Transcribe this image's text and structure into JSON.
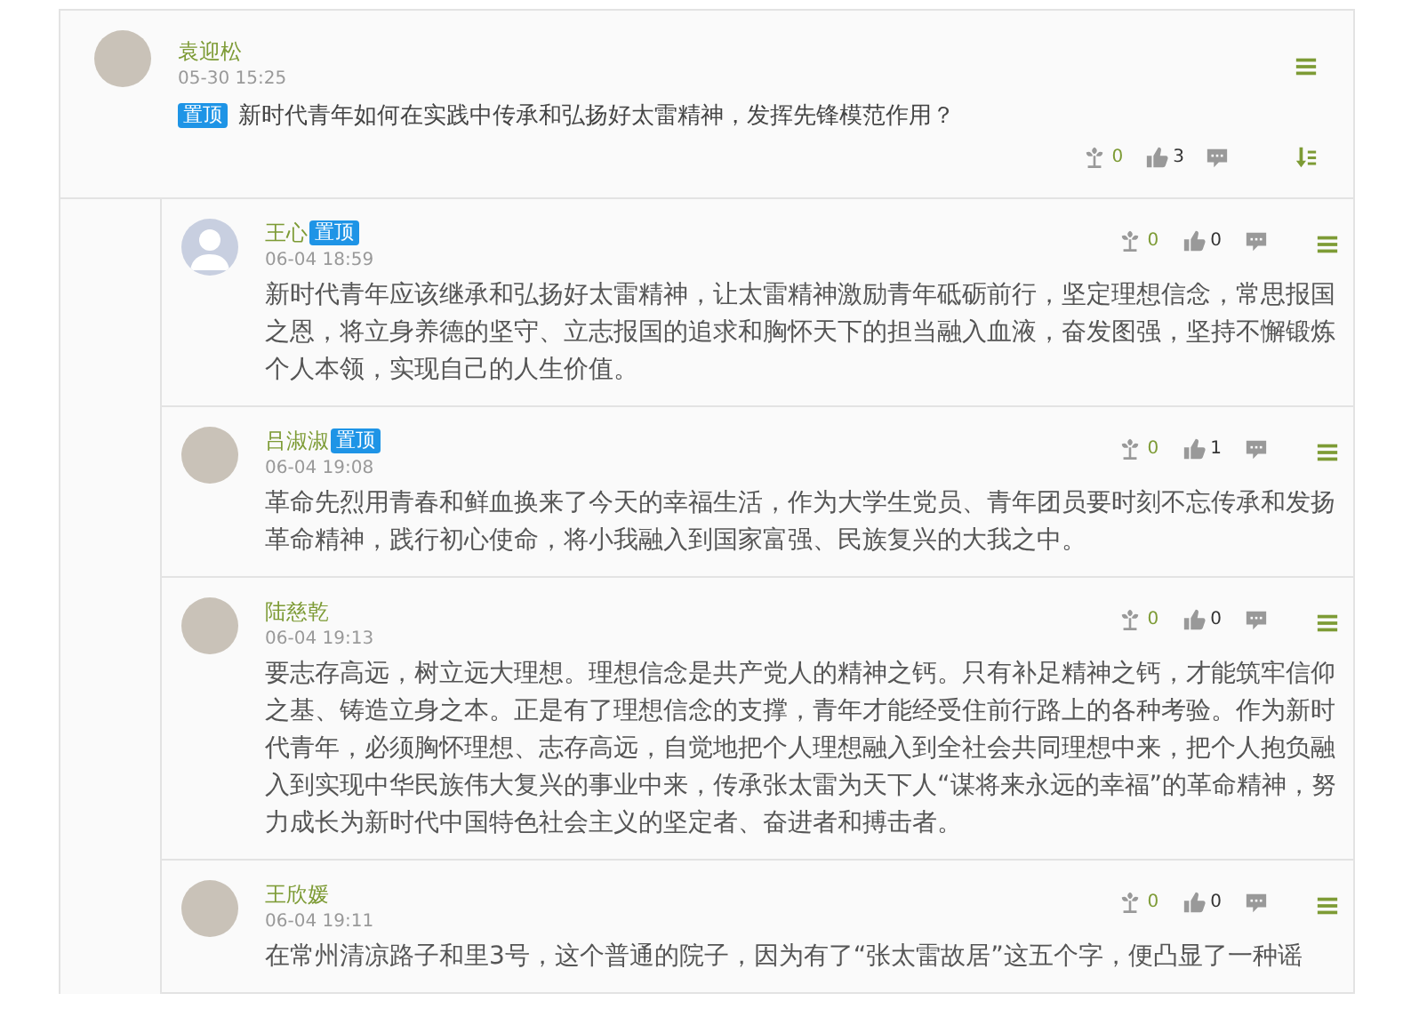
{
  "post": {
    "author": "袁迎松",
    "kind": "photo",
    "time": "05-30 15:25",
    "pinned": true,
    "pinned_label": "置顶",
    "title": "新时代青年如何在实践中传承和弘扬好太雷精神，发挥先锋模范作用？",
    "flowers": "0",
    "likes": "3"
  },
  "replies": [
    {
      "author": "王心",
      "kind": "default",
      "pinned": true,
      "pinned_label": "置顶",
      "time": "06-04 18:59",
      "flowers": "0",
      "likes": "0",
      "text": "新时代青年应该继承和弘扬好太雷精神，让太雷精神激励青年砥砺前行，坚定理想信念，常思报国之恩，将立身养德的坚守、立志报国的追求和胸怀天下的担当融入血液，奋发图强，坚持不懈锻炼个人本领，实现自己的人生价值。"
    },
    {
      "author": "吕淑淑",
      "kind": "photo",
      "pinned": true,
      "pinned_label": "置顶",
      "time": "06-04 19:08",
      "flowers": "0",
      "likes": "1",
      "text": "革命先烈用青春和鲜血换来了今天的幸福生活，作为大学生党员、青年团员要时刻不忘传承和发扬革命精神，践行初心使命，将小我融入到国家富强、民族复兴的大我之中。"
    },
    {
      "author": "陆慈乾",
      "kind": "photo",
      "pinned": false,
      "time": "06-04 19:13",
      "flowers": "0",
      "likes": "0",
      "text": "要志存高远，树立远大理想。理想信念是共产党人的精神之钙。只有补足精神之钙，才能筑牢信仰之基、铸造立身之本。正是有了理想信念的支撑，青年才能经受住前行路上的各种考验。作为新时代青年，必须胸怀理想、志存高远，自觉地把个人理想融入到全社会共同理想中来，把个人抱负融入到实现中华民族伟大复兴的事业中来，传承张太雷为天下人“谋将来永远的幸福”的革命精神，努力成长为新时代中国特色社会主义的坚定者、奋进者和搏击者。"
    },
    {
      "author": "王欣媛",
      "kind": "photo",
      "pinned": false,
      "time": "06-04 19:11",
      "flowers": "0",
      "likes": "0",
      "text": "在常州清凉路子和里3号，这个普通的院子，因为有了“张太雷故居”这五个字，便凸显了一种谣"
    }
  ]
}
